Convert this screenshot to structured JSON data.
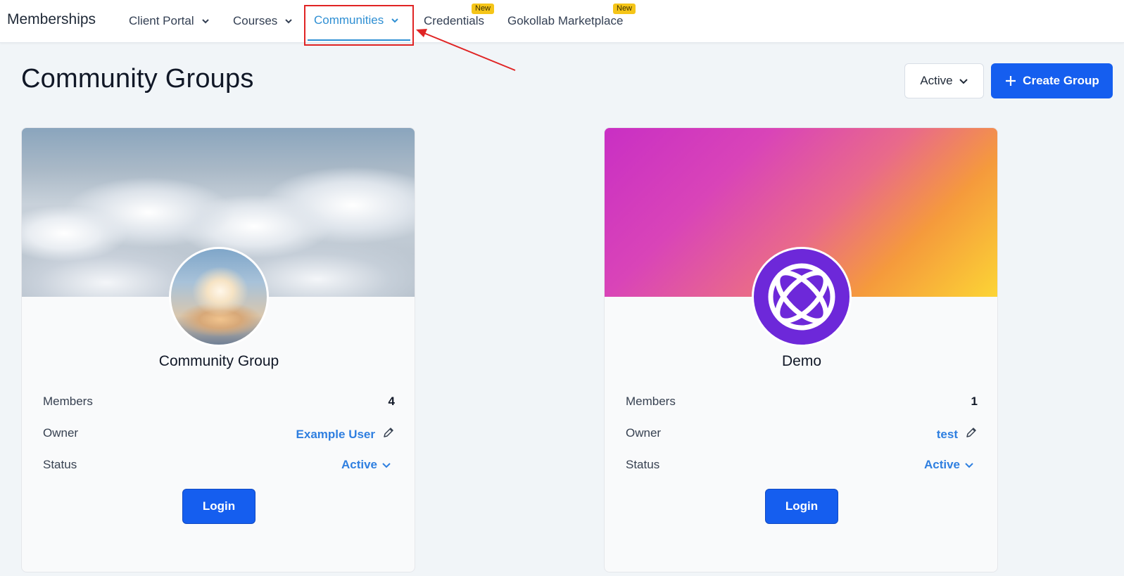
{
  "nav": {
    "brand": "Memberships",
    "items": [
      {
        "label": "Client Portal",
        "has_dropdown": true
      },
      {
        "label": "Courses",
        "has_dropdown": true
      },
      {
        "label": "Communities",
        "has_dropdown": true,
        "active": true
      },
      {
        "label": "Credentials",
        "badge": "New"
      },
      {
        "label": "Gokollab Marketplace",
        "badge": "New"
      }
    ]
  },
  "page": {
    "title": "Community Groups",
    "filter_label": "Active",
    "create_label": "Create Group"
  },
  "cards": [
    {
      "title": "Community Group",
      "members_label": "Members",
      "members": "4",
      "owner_label": "Owner",
      "owner": "Example User",
      "status_label": "Status",
      "status": "Active",
      "login_label": "Login"
    },
    {
      "title": "Demo",
      "members_label": "Members",
      "members": "1",
      "owner_label": "Owner",
      "owner": "test",
      "status_label": "Status",
      "status": "Active",
      "login_label": "Login"
    }
  ],
  "colors": {
    "primary": "#155eef",
    "active_nav": "#2f8fd3",
    "badge": "#f5c518",
    "annotation": "#e02424",
    "link": "#2f7fe0"
  }
}
